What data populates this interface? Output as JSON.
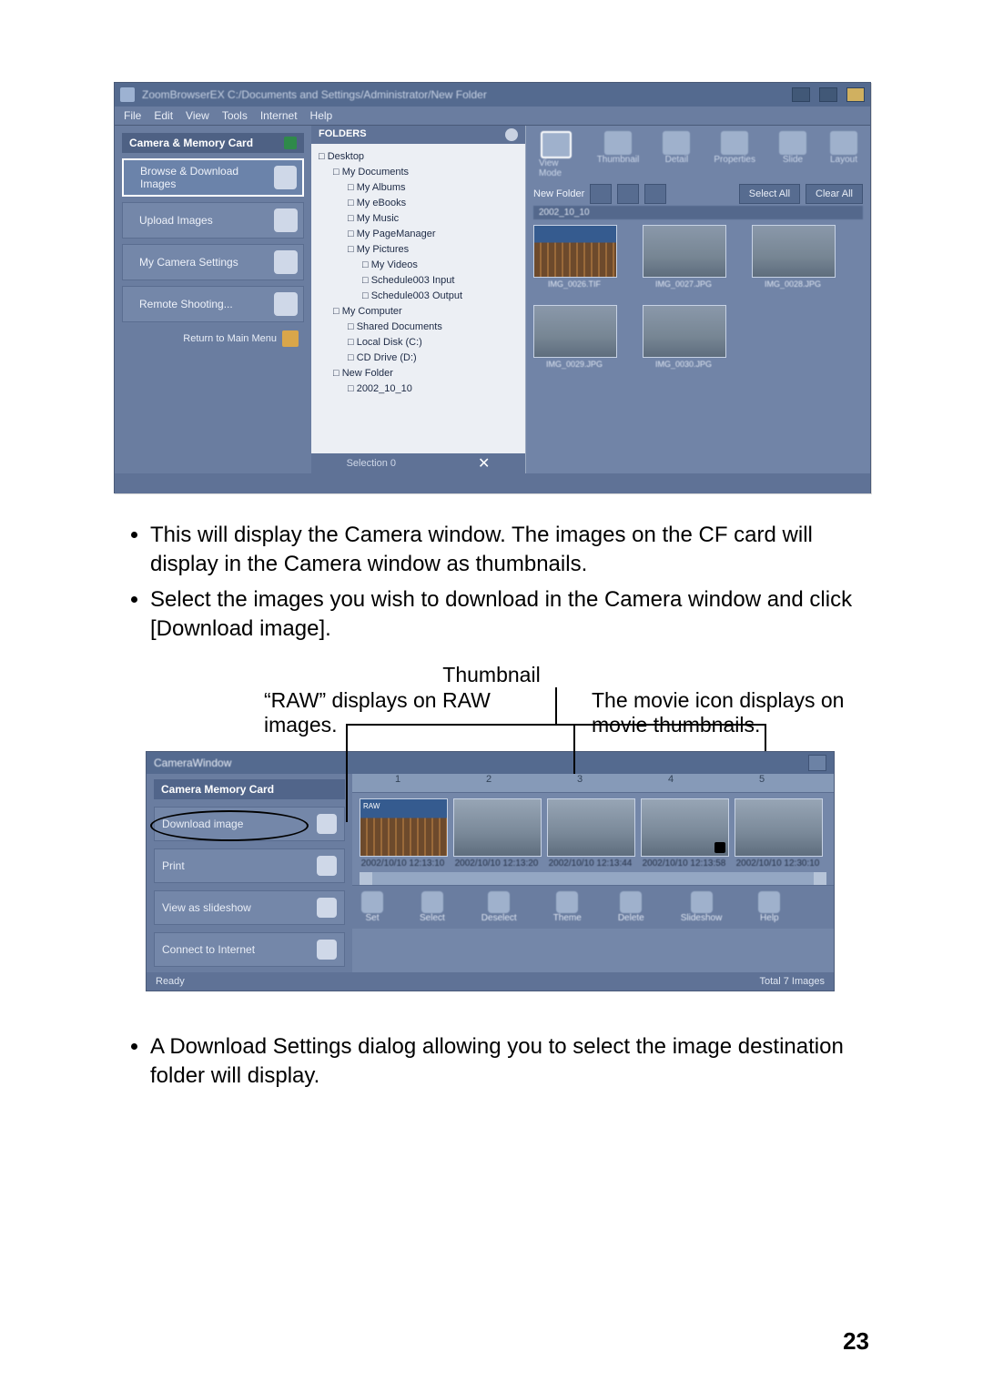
{
  "zb": {
    "title": "ZoomBrowserEX   C:/Documents and Settings/Administrator/New Folder",
    "menu": [
      "File",
      "Edit",
      "View",
      "Tools",
      "Internet",
      "Help"
    ],
    "left_header": "Camera & Memory Card",
    "nav": [
      {
        "label": "Browse & Download Images",
        "sel": true
      },
      {
        "label": "Upload Images"
      },
      {
        "label": "My Camera Settings"
      },
      {
        "label": "Remote Shooting..."
      }
    ],
    "return_label": "Return to Main Menu",
    "folders_hdr": "FOLDERS",
    "tree": [
      {
        "d": 0,
        "t": "□ Desktop"
      },
      {
        "d": 1,
        "t": "□ My Documents"
      },
      {
        "d": 2,
        "t": "□ My Albums"
      },
      {
        "d": 2,
        "t": "□ My eBooks"
      },
      {
        "d": 2,
        "t": "□ My Music"
      },
      {
        "d": 2,
        "t": "□ My PageManager"
      },
      {
        "d": 2,
        "t": "□ My Pictures"
      },
      {
        "d": 3,
        "t": "□ My Videos"
      },
      {
        "d": 3,
        "t": "□ Schedule003 Input"
      },
      {
        "d": 3,
        "t": "□ Schedule003 Output"
      },
      {
        "d": 1,
        "t": "□ My Computer"
      },
      {
        "d": 2,
        "t": "□ Shared Documents"
      },
      {
        "d": 2,
        "t": "□ Local Disk (C:)"
      },
      {
        "d": 2,
        "t": "□ CD Drive (D:)"
      },
      {
        "d": 1,
        "t": "□ New Folder"
      },
      {
        "d": 2,
        "t": "□ 2002_10_10"
      }
    ],
    "strip_label": "Selection  0",
    "modes": [
      "View Mode",
      "Thumbnail",
      "Detail",
      "Properties",
      "Slide",
      "Layout"
    ],
    "bar2_label": "New Folder",
    "bar2_btn1": "Select All",
    "bar2_btn2": "Clear All",
    "path": "2002_10_10",
    "thumbs": [
      "IMG_0026.TIF",
      "IMG_0027.JPG",
      "IMG_0028.JPG",
      "IMG_0029.JPG",
      "IMG_0030.JPG"
    ]
  },
  "bullets1": [
    "This will display the Camera window. The images on the CF card will display in the Camera window as thumbnails.",
    "Select the images you wish to download in the Camera window and click [Download image]."
  ],
  "callouts": {
    "center": "Thumbnail",
    "left": "“RAW” displays on RAW images.",
    "right": "The movie icon displays on movie thumbnails."
  },
  "cw": {
    "title": "CameraWindow",
    "left_header": "Camera Memory Card",
    "rows": [
      "Download image",
      "Print",
      "View as slideshow",
      "Connect to Internet"
    ],
    "ruler": [
      "1",
      "2",
      "3",
      "4",
      "5"
    ],
    "thumbs": [
      {
        "cap": "2002/10/10 12:13:10",
        "city": true,
        "raw": true
      },
      {
        "cap": "2002/10/10 12:13:20"
      },
      {
        "cap": "2002/10/10 12:13:44"
      },
      {
        "cap": "2002/10/10 12:13:58",
        "mov": true
      },
      {
        "cap": "2002/10/10 12:30:10"
      }
    ],
    "toolbar": [
      "Set",
      "Select",
      "Deselect",
      "Theme",
      "Delete",
      "Slideshow",
      "Help"
    ],
    "status_left": "Ready",
    "status_right": "Total 7 Images"
  },
  "bullets2": [
    "A Download Settings dialog allowing you to select the image destination folder will display."
  ],
  "ellipse_target": "Download image",
  "page_number": "23"
}
